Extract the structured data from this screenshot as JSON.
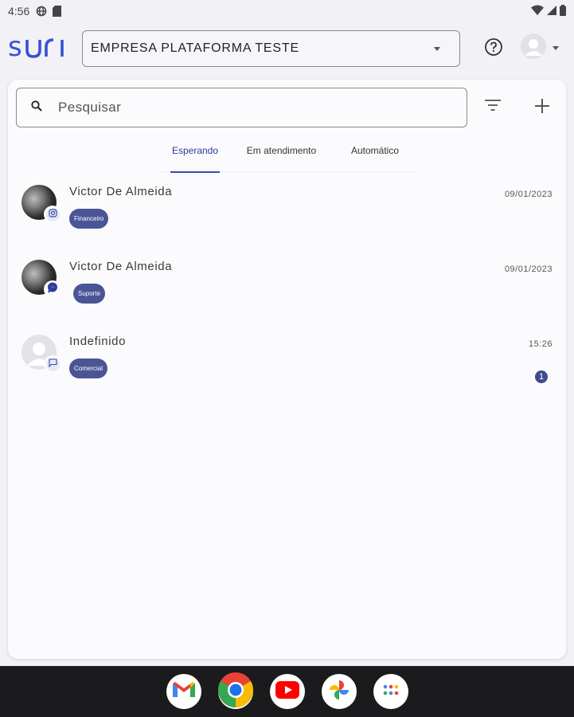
{
  "status_bar": {
    "time": "4:56"
  },
  "header": {
    "logo": "SUri",
    "company": "EMPRESA PLATAFORMA TESTE"
  },
  "search": {
    "placeholder": "Pesquisar"
  },
  "tabs": [
    {
      "label": "Esperando",
      "active": true
    },
    {
      "label": "Em atendimento",
      "active": false
    },
    {
      "label": "Automático",
      "active": false
    }
  ],
  "conversations": [
    {
      "name": "Victor De Almeida",
      "date": "09/01/2023",
      "tag": "Financeiro",
      "channel": "instagram-icon",
      "unread": ""
    },
    {
      "name": "Victor De Almeida",
      "date": "09/01/2023",
      "tag": "Suporte",
      "channel": "messenger-icon",
      "unread": ""
    },
    {
      "name": "Indefinido",
      "date": "15:26",
      "tag": "Comercial",
      "channel": "chat-bubble-icon",
      "unread": "1"
    }
  ],
  "colors": {
    "brand": "#3552d6",
    "tag_bg": "#4a5596",
    "active_tab": "#3a4aa8"
  },
  "dock": [
    "gmail-icon",
    "chrome-icon",
    "youtube-icon",
    "photos-icon",
    "app-drawer-icon"
  ]
}
